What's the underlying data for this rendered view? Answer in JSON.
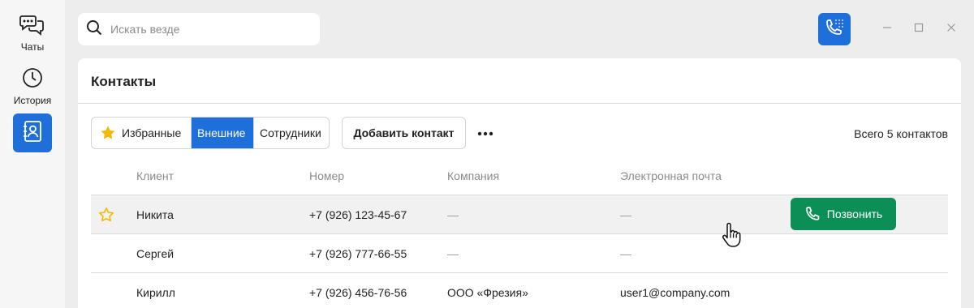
{
  "sidebar": {
    "items": [
      {
        "label": "Чаты",
        "icon": "chats-icon"
      },
      {
        "label": "История",
        "icon": "history-icon"
      },
      {
        "label": "",
        "icon": "contacts-icon",
        "active": true
      }
    ]
  },
  "search": {
    "placeholder": "Искать везде",
    "value": ""
  },
  "panel": {
    "title": "Контакты",
    "tabs": [
      {
        "label": "Избранные",
        "icon": "star-icon",
        "active": false
      },
      {
        "label": "Внешние",
        "active": true
      },
      {
        "label": "Сотрудники",
        "active": false
      }
    ],
    "add_contact_label": "Добавить контакт",
    "total_label": "Всего 5 контактов"
  },
  "table": {
    "columns": [
      "Клиент",
      "Номер",
      "Компания",
      "Электронная почта"
    ],
    "rows": [
      {
        "favorite": true,
        "client": "Никита",
        "number": "+7 (926) 123-45-67",
        "company": "—",
        "email": "—",
        "hover": true
      },
      {
        "favorite": false,
        "client": "Сергей",
        "number": "+7 (926) 777-66-55",
        "company": "—",
        "email": "—"
      },
      {
        "favorite": false,
        "client": "Кирилл",
        "number": "+7 (926) 456-76-56",
        "company": "ООО «Фрезия»",
        "email": "user1@company.com"
      }
    ],
    "call_label": "Позвонить"
  },
  "colors": {
    "accent": "#1e6fd9",
    "call": "#0c8f56",
    "star": "#f5b800"
  }
}
